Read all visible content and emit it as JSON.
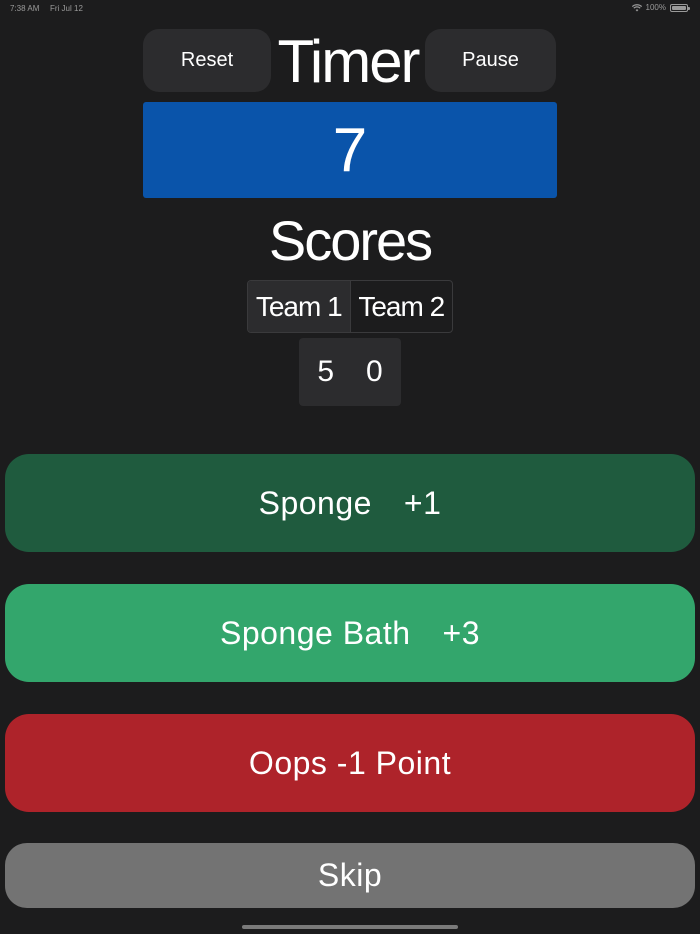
{
  "status_bar": {
    "time": "7:38 AM",
    "date": "Fri Jul 12",
    "battery": "100%",
    "wifi_icon": "wifi-icon",
    "battery_icon": "battery-icon"
  },
  "header": {
    "reset_label": "Reset",
    "title": "Timer",
    "pause_label": "Pause"
  },
  "timer": {
    "value": "7",
    "color": "#0a54aa"
  },
  "scores": {
    "title": "Scores",
    "teams": [
      "Team 1",
      "Team 2"
    ],
    "selected_team": "Team 1",
    "values": [
      "5",
      "0"
    ]
  },
  "actions": {
    "sponge": {
      "label": "Sponge",
      "points": "+1",
      "color": "#1f5b3e"
    },
    "sponge_bath": {
      "label": "Sponge Bath",
      "points": "+3",
      "color": "#33a66c"
    },
    "oops": {
      "label": "Oops -1 Point",
      "color": "#ae232a"
    },
    "skip": {
      "label": "Skip",
      "color": "#737373"
    }
  }
}
